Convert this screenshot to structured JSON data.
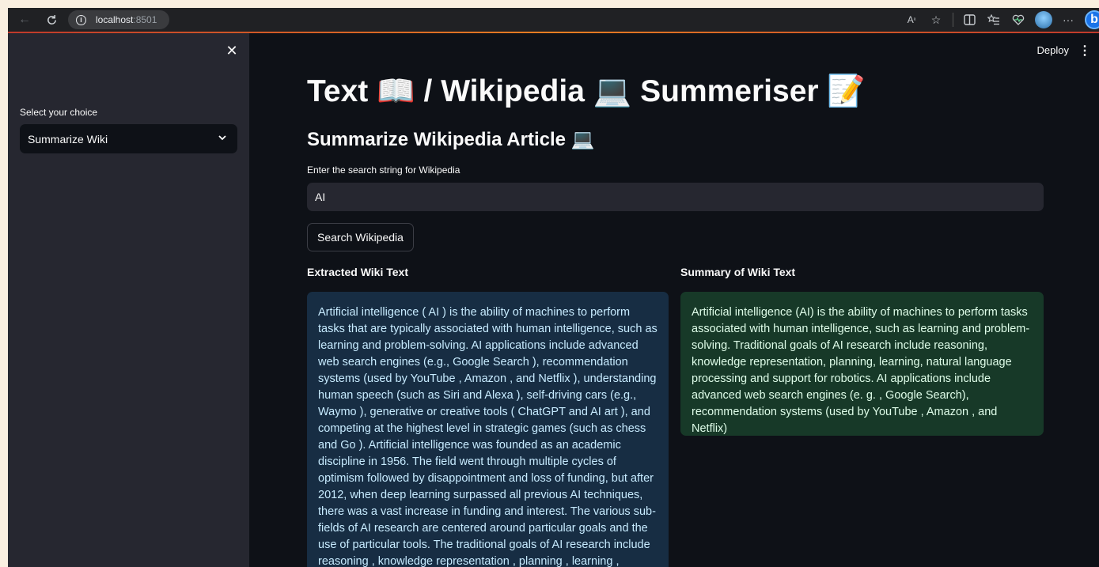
{
  "browser": {
    "url_host": "localhost",
    "url_port": ":8501"
  },
  "sidebar": {
    "select_label": "Select your choice",
    "select_value": "Summarize Wiki"
  },
  "header": {
    "deploy_label": "Deploy"
  },
  "main": {
    "title": "Text 📖 / Wikipedia 💻 Summeriser 📝",
    "subtitle": "Summarize Wikipedia Article 💻",
    "input_label": "Enter the search string for Wikipedia",
    "input_value": "AI",
    "search_button": "Search Wikipedia",
    "extracted_heading": "Extracted Wiki Text",
    "summary_heading": "Summary of Wiki Text",
    "extracted_text": "Artificial intelligence ( AI ) is the ability of machines to perform tasks that are typically associated with human intelligence, such as learning and problem-solving. AI applications include advanced web search engines (e.g., Google Search ), recommendation systems (used by YouTube , Amazon , and Netflix ), understanding human speech (such as Siri and Alexa ), self-driving cars (e.g., Waymo ), generative or creative tools ( ChatGPT and AI art ), and competing at the highest level in strategic games (such as chess and Go ). Artificial intelligence was founded as an academic discipline in 1956. The field went through multiple cycles of optimism followed by disappointment and loss of funding, but after 2012, when deep learning surpassed all previous AI techniques, there was a vast increase in funding and interest. The various sub-fields of AI research are centered around particular goals and the use of particular tools. The traditional goals of AI research include reasoning , knowledge representation , planning , learning ,",
    "summary_text": "Artificial intelligence (AI) is the ability of machines to perform tasks associated with human intelligence, such as learning and problem-solving. Traditional goals of AI research include reasoning, knowledge representation, planning, learning, natural language processing and support for robotics. AI applications include advanced web search engines (e. g. , Google Search), recommendation systems (used by YouTube , Amazon , and Netflix)"
  },
  "icons": {
    "back": "back-arrow-icon",
    "reload": "reload-icon",
    "info": "info-icon",
    "read_aloud": "read-aloud-icon",
    "favorite": "star-icon",
    "split_screen": "split-screen-icon",
    "favorites": "favorites-list-icon",
    "health": "browser-essentials-icon",
    "profile": "profile-avatar-icon",
    "more": "more-icon",
    "copilot": "bing-copilot-icon",
    "close": "close-icon",
    "chevron": "chevron-down-icon",
    "kebab": "kebab-menu-icon"
  }
}
